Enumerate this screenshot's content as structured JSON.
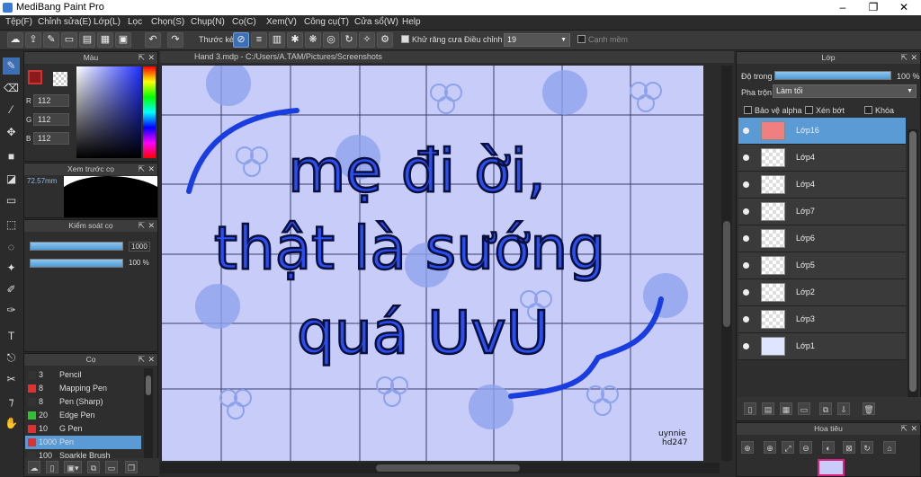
{
  "app": {
    "title": "MediBang Paint Pro"
  },
  "menu": [
    "Tệp(F)",
    "Chỉnh sửa(E)",
    "Lớp(L)",
    "Lọc",
    "Chọn(S)",
    "Chụp(N)",
    "Cọ(C)",
    "Xem(V)",
    "Công cụ(T)",
    "Cửa sổ(W)",
    "Help"
  ],
  "toolbar": {
    "ruler_label": "Thước kẻ",
    "antialias_label": "Khử răng cưa",
    "correction_label": "Điều chỉnh",
    "correction_value": "19",
    "edge_label": "Cạnh mềm"
  },
  "color_panel": {
    "title": "Màu",
    "r": "112",
    "g": "112",
    "b": "112",
    "r_label": "R",
    "g_label": "G",
    "b_label": "B",
    "fg_color": "#700000",
    "hex_fg": "#8b1a1a"
  },
  "preview_panel": {
    "title": "Xem trước cọ",
    "size": "72.57mm"
  },
  "brush_control": {
    "title": "Kiểm soát cọ",
    "size": "1000",
    "opacity": "100 %"
  },
  "brush_panel": {
    "title": "Cọ",
    "items": [
      {
        "n": "3",
        "name": "Pencil",
        "color": "#333333"
      },
      {
        "n": "8",
        "name": "Mapping Pen",
        "color": "#e03030"
      },
      {
        "n": "8",
        "name": "Pen (Sharp)",
        "color": "#333333"
      },
      {
        "n": "20",
        "name": "Edge Pen",
        "color": "#30c030"
      },
      {
        "n": "10",
        "name": "G Pen",
        "color": "#e03030"
      },
      {
        "n": "1000",
        "name": "Pen",
        "color": "#e03030"
      },
      {
        "n": "100",
        "name": "Sparkle Brush",
        "color": "#333333"
      }
    ]
  },
  "canvas": {
    "tab": "Hand 3.mdp - C:/Users/A.TAM/Pictures/Screenshots",
    "line1": "mẹ đi ời,",
    "line2": "thật là sướng",
    "line3": "quá UvU",
    "signature1": "uynnie",
    "signature2": "hd247"
  },
  "layer_panel": {
    "title": "Lớp",
    "opacity_label": "Độ trong",
    "opacity_value": "100 %",
    "blend_label": "Pha trộn",
    "blend_value": "Làm tối",
    "protect_alpha": "Bảo vệ alpha",
    "clip": "Xén bớt",
    "lock": "Khóa",
    "layers": [
      {
        "name": "Lớp16",
        "selected": true
      },
      {
        "name": "Lớp4"
      },
      {
        "name": "Lớp4"
      },
      {
        "name": "Lớp7"
      },
      {
        "name": "Lớp6"
      },
      {
        "name": "Lớp5"
      },
      {
        "name": "Lớp2"
      },
      {
        "name": "Lớp3"
      },
      {
        "name": "Lớp1"
      }
    ]
  },
  "navigator": {
    "title": "Hoa tiêu"
  }
}
